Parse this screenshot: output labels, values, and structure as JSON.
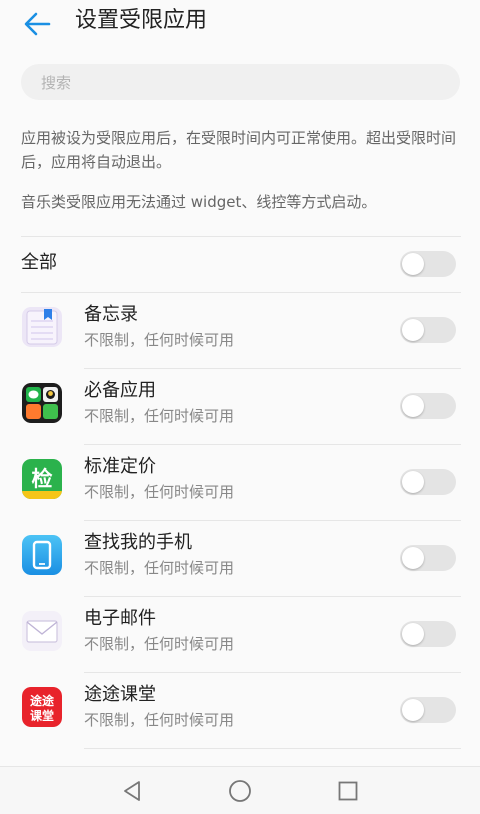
{
  "header": {
    "title": "设置受限应用",
    "back_icon": "arrow-left-icon"
  },
  "search": {
    "placeholder": "搜索"
  },
  "description": {
    "line1": "应用被设为受限应用后，在受限时间内可正常使用。超出受限时间后，应用将自动退出。",
    "line2": "音乐类受限应用无法通过 widget、线控等方式启动。"
  },
  "all": {
    "label": "全部",
    "enabled": false
  },
  "apps": [
    {
      "name": "备忘录",
      "subtitle": "不限制，任何时候可用",
      "icon": "memo-icon",
      "enabled": false
    },
    {
      "name": "必备应用",
      "subtitle": "不限制，任何时候可用",
      "icon": "essential-apps-icon",
      "enabled": false
    },
    {
      "name": "标准定价",
      "subtitle": "不限制，任何时候可用",
      "icon": "standard-pricing-icon",
      "enabled": false
    },
    {
      "name": "查找我的手机",
      "subtitle": "不限制，任何时候可用",
      "icon": "find-my-phone-icon",
      "enabled": false
    },
    {
      "name": "电子邮件",
      "subtitle": "不限制，任何时候可用",
      "icon": "email-icon",
      "enabled": false
    },
    {
      "name": "途途课堂",
      "subtitle": "不限制，任何时候可用",
      "icon": "tutu-classroom-icon",
      "enabled": false
    }
  ],
  "icon_labels": {
    "standard_pricing": "检",
    "tutu_classroom_top": "途途",
    "tutu_classroom_bottom": "课堂"
  },
  "partial_next_item": "",
  "navbar": {
    "back": "nav-back-icon",
    "home": "nav-home-icon",
    "recents": "nav-recents-icon"
  },
  "colors": {
    "accent": "#1a8fe3",
    "toggle_off": "#e4e4e4",
    "text_primary": "#222222",
    "text_secondary": "#888888"
  }
}
